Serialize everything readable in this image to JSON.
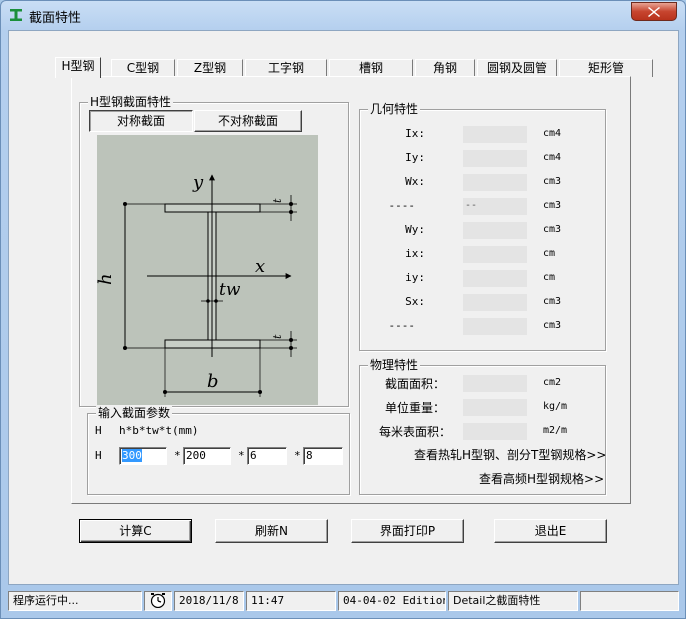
{
  "window": {
    "title": "截面特性"
  },
  "tabs": [
    {
      "label": "H型钢",
      "active": true
    },
    {
      "label": "C型钢"
    },
    {
      "label": "Z型钢"
    },
    {
      "label": "工字钢"
    },
    {
      "label": "槽钢"
    },
    {
      "label": "角钢"
    },
    {
      "label": "圆钢及圆管"
    },
    {
      "label": "矩形管"
    }
  ],
  "section": {
    "group_title": "H型钢截面特性",
    "symmetric_label": "对称截面",
    "asymmetric_label": "不对称截面",
    "diagram": {
      "y": "y",
      "x": "x",
      "h": "h",
      "b": "b",
      "tw": "tw",
      "t_top": "t",
      "t_bottom": "t"
    }
  },
  "geometry": {
    "group_title": "几何特性",
    "rows": [
      {
        "label": "Ix:",
        "value": "",
        "unit": "cm4"
      },
      {
        "label": "Iy:",
        "value": "",
        "unit": "cm4"
      },
      {
        "label": "Wx:",
        "value": "",
        "unit": "cm3"
      },
      {
        "label": "----",
        "value": "--",
        "unit": "cm3"
      },
      {
        "label": "Wy:",
        "value": "",
        "unit": "cm3"
      },
      {
        "label": "ix:",
        "value": "",
        "unit": "cm"
      },
      {
        "label": "iy:",
        "value": "",
        "unit": "cm"
      },
      {
        "label": "Sx:",
        "value": "",
        "unit": "cm3"
      },
      {
        "label": "----",
        "value": "",
        "unit": "cm3"
      }
    ]
  },
  "physical": {
    "group_title": "物理特性",
    "rows": [
      {
        "label": "截面面积：",
        "value": "",
        "unit": "cm2"
      },
      {
        "label": "单位重量：",
        "value": "",
        "unit": "kg/m"
      },
      {
        "label": "每米表面积：",
        "value": "",
        "unit": "m2/m"
      }
    ],
    "link_hot_rolled": "查看热轧H型钢、剖分T型钢规格>>",
    "link_high_freq": "查看高频H型钢规格>>"
  },
  "input": {
    "group_title": "输入截面参数",
    "format_prefix": "H",
    "format": "h*b*tw*t(mm)",
    "row_prefix": "H",
    "h": "300",
    "b": "200",
    "tw": "6",
    "t": "8",
    "sep": "*"
  },
  "buttons": {
    "calc": "计算C",
    "refresh": "刷新N",
    "print": "界面打印P",
    "exit": "退出E"
  },
  "status": {
    "running": "程序运行中...",
    "date": "2018/11/8",
    "time": "11:47",
    "edition": "04-04-02 Edition",
    "detail": "Detail之截面特性"
  }
}
